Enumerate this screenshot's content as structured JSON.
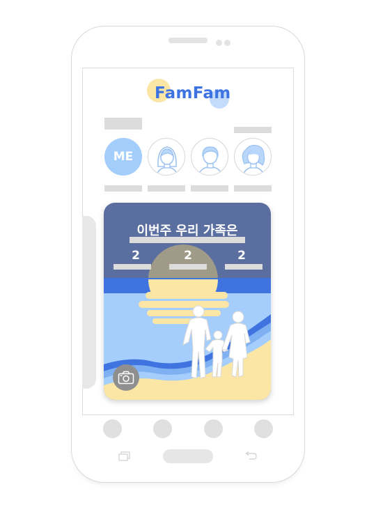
{
  "app": {
    "logo_text": "FamFam"
  },
  "profiles": [
    {
      "label": "ME",
      "icon": "me-avatar"
    },
    {
      "label": "",
      "icon": "girl-avatar-icon"
    },
    {
      "label": "",
      "icon": "boy-avatar-icon"
    },
    {
      "label": "",
      "icon": "mother-avatar-icon"
    }
  ],
  "card": {
    "title": "이번주 우리 가족은",
    "stats": [
      "2",
      "2",
      "2"
    ],
    "camera_icon": "camera-icon"
  },
  "colors": {
    "brand_blue": "#3d74e2",
    "card_header": "#5a6ea0",
    "sea": "#3f74e0",
    "sky_light": "#a6cefc",
    "sand": "#fbe6a6",
    "me_avatar": "#a3cdfb"
  },
  "bottom_nav": {
    "items": [
      "",
      "",
      "",
      ""
    ]
  },
  "system_keys": {
    "recent": "recent-apps-icon",
    "home": "home-key",
    "back": "back-icon"
  }
}
